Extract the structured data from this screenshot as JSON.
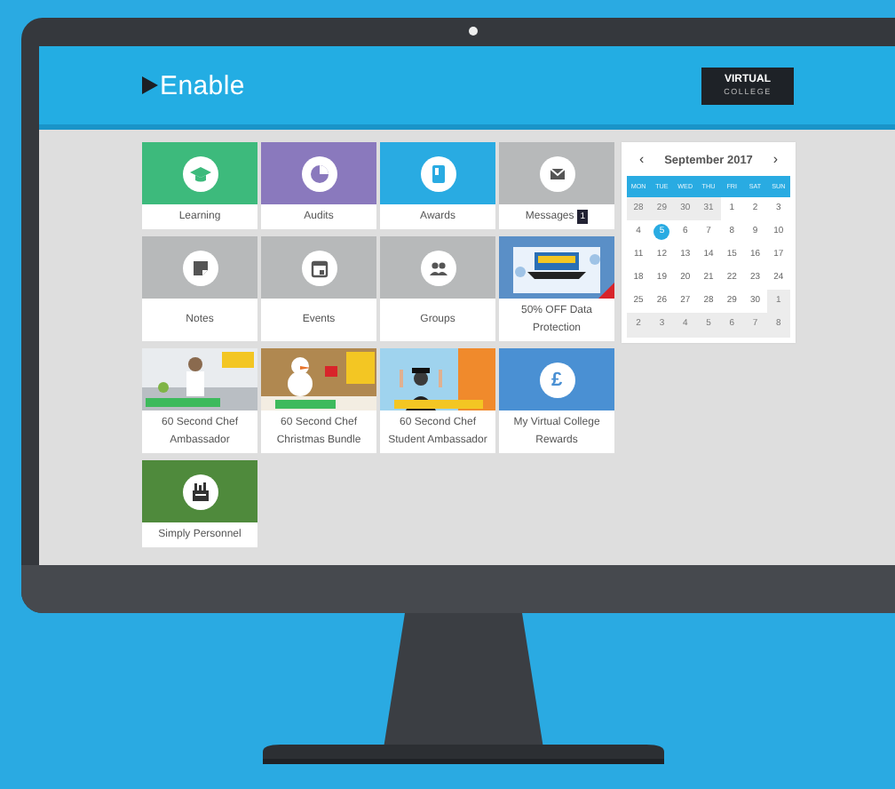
{
  "screen": {
    "header": {
      "title": "Enable",
      "logo": {
        "line_1": "VIRTUAL",
        "line_2": "COLLEGE"
      }
    },
    "tiles": [
      {
        "kind": "icon",
        "label": "Learning",
        "color": "#3dba7c"
      },
      {
        "kind": "icon",
        "label": "Audits",
        "color": "#8a79bd"
      },
      {
        "kind": "icon",
        "label": "Awards",
        "color": "#29abe2"
      },
      {
        "kind": "icon",
        "label": "Messages",
        "color": "#b7b9ba",
        "badge": "1"
      },
      {
        "kind": "icon",
        "label": "Notes",
        "color": "#b7b9ba"
      },
      {
        "kind": "icon",
        "label": "Events",
        "color": "#b7b9ba"
      },
      {
        "kind": "icon",
        "label": "Groups",
        "color": "#b7b9ba"
      },
      {
        "kind": "picture",
        "label": "50% OFF Data Protection"
      },
      {
        "kind": "picture",
        "label": "60 Second Chef Ambassador"
      },
      {
        "kind": "picture",
        "label": "60 Second Chef Christmas Bundle"
      },
      {
        "kind": "picture",
        "label": "60 Second Chef Student Ambassador"
      },
      {
        "kind": "symbol",
        "label": "My Virtual College Rewards",
        "color": "#4a90d3",
        "symbol": "£"
      },
      {
        "kind": "icon",
        "label": "Simply Personnel",
        "color": "#4f8a3c"
      }
    ],
    "calendar": {
      "prev": "‹",
      "month": "September 2017",
      "next": "›",
      "weekdays": [
        "MON",
        "TUE",
        "WED",
        "THU",
        "FRI",
        "SAT",
        "SUN"
      ],
      "weeks": [
        [
          {
            "day": "28",
            "in_month": false,
            "selected": false
          },
          {
            "day": "29",
            "in_month": false,
            "selected": false
          },
          {
            "day": "30",
            "in_month": false,
            "selected": false
          },
          {
            "day": "31",
            "in_month": false,
            "selected": false
          },
          {
            "day": "1",
            "in_month": true,
            "selected": false
          },
          {
            "day": "2",
            "in_month": true,
            "selected": false
          },
          {
            "day": "3",
            "in_month": true,
            "selected": false
          }
        ],
        [
          {
            "day": "4",
            "in_month": true,
            "selected": false
          },
          {
            "day": "5",
            "in_month": true,
            "selected": true
          },
          {
            "day": "6",
            "in_month": true,
            "selected": false
          },
          {
            "day": "7",
            "in_month": true,
            "selected": false
          },
          {
            "day": "8",
            "in_month": true,
            "selected": false
          },
          {
            "day": "9",
            "in_month": true,
            "selected": false
          },
          {
            "day": "10",
            "in_month": true,
            "selected": false
          }
        ],
        [
          {
            "day": "11",
            "in_month": true,
            "selected": false
          },
          {
            "day": "12",
            "in_month": true,
            "selected": false
          },
          {
            "day": "13",
            "in_month": true,
            "selected": false
          },
          {
            "day": "14",
            "in_month": true,
            "selected": false
          },
          {
            "day": "15",
            "in_month": true,
            "selected": false
          },
          {
            "day": "16",
            "in_month": true,
            "selected": false
          },
          {
            "day": "17",
            "in_month": true,
            "selected": false
          }
        ],
        [
          {
            "day": "18",
            "in_month": true,
            "selected": false
          },
          {
            "day": "19",
            "in_month": true,
            "selected": false
          },
          {
            "day": "20",
            "in_month": true,
            "selected": false
          },
          {
            "day": "21",
            "in_month": true,
            "selected": false
          },
          {
            "day": "22",
            "in_month": true,
            "selected": false
          },
          {
            "day": "23",
            "in_month": true,
            "selected": false
          },
          {
            "day": "24",
            "in_month": true,
            "selected": false
          }
        ],
        [
          {
            "day": "25",
            "in_month": true,
            "selected": false
          },
          {
            "day": "26",
            "in_month": true,
            "selected": false
          },
          {
            "day": "27",
            "in_month": true,
            "selected": false
          },
          {
            "day": "28",
            "in_month": true,
            "selected": false
          },
          {
            "day": "29",
            "in_month": true,
            "selected": false
          },
          {
            "day": "30",
            "in_month": true,
            "selected": false
          },
          {
            "day": "1",
            "in_month": false,
            "selected": false
          }
        ],
        [
          {
            "day": "2",
            "in_month": false,
            "selected": false
          },
          {
            "day": "3",
            "in_month": false,
            "selected": false
          },
          {
            "day": "4",
            "in_month": false,
            "selected": false
          },
          {
            "day": "5",
            "in_month": false,
            "selected": false
          },
          {
            "day": "6",
            "in_month": false,
            "selected": false
          },
          {
            "day": "7",
            "in_month": false,
            "selected": false
          },
          {
            "day": "8",
            "in_month": false,
            "selected": false
          }
        ]
      ]
    }
  }
}
